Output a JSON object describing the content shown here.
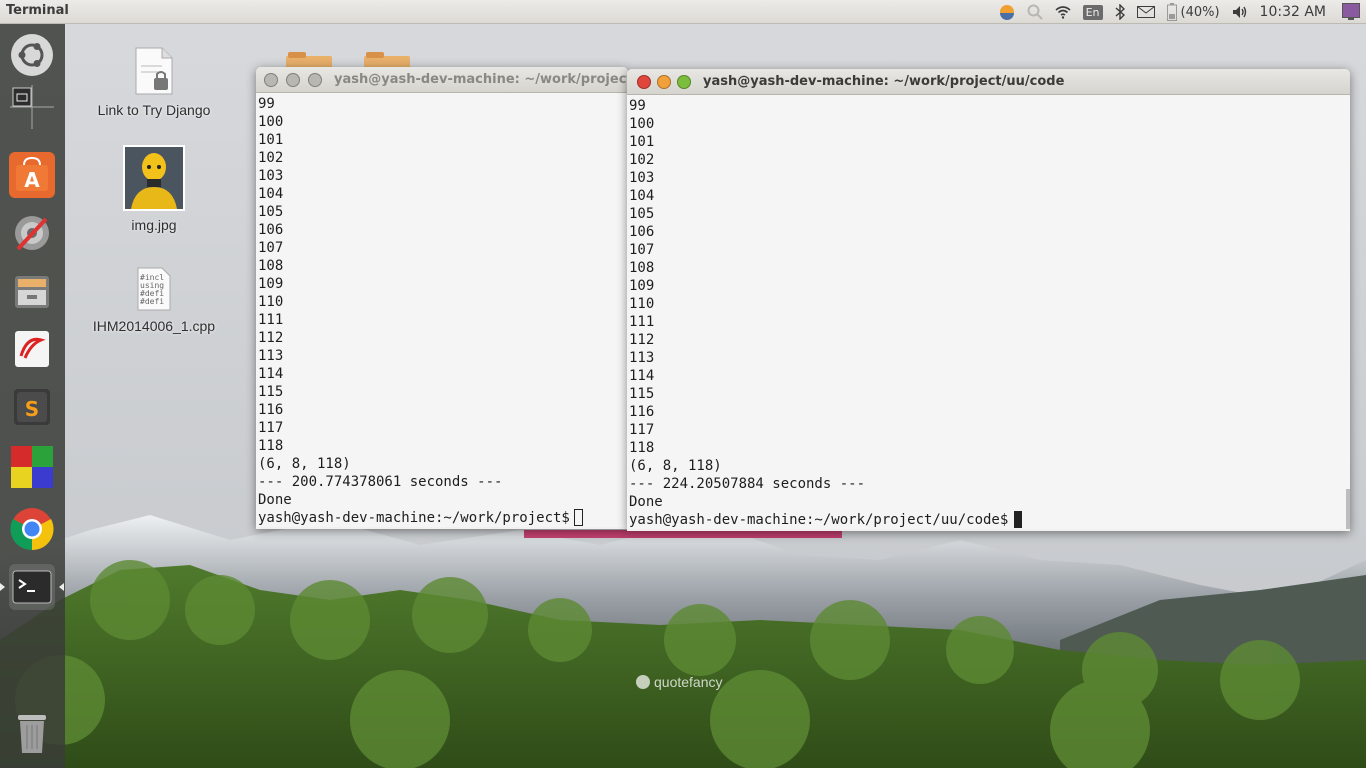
{
  "top_panel": {
    "app_title": "Terminal",
    "battery": "(40%)",
    "keyboard_layout": "En",
    "clock": "10:32 AM"
  },
  "desktop": {
    "icons": [
      {
        "label": "Link to Try Django",
        "icon": "file-link-icon"
      },
      {
        "label": "img.jpg",
        "icon": "image-thumbnail-icon"
      },
      {
        "label": "IHM2014006_1.cpp",
        "icon": "cpp-file-icon"
      }
    ],
    "watermark": "quotefancy"
  },
  "launcher": {
    "items": [
      "ubuntu-dash-icon",
      "workspace-switcher-icon",
      "software-center-icon",
      "system-settings-icon",
      "file-manager-icon",
      "document-viewer-icon",
      "sublime-text-icon",
      "puzzle-game-icon",
      "chrome-icon",
      "terminal-icon",
      "trash-icon"
    ]
  },
  "terminal_left": {
    "title": "yash@yash-dev-machine: ~/work/project",
    "lines": [
      "99",
      "100",
      "101",
      "102",
      "103",
      "104",
      "105",
      "106",
      "107",
      "108",
      "109",
      "110",
      "111",
      "112",
      "113",
      "114",
      "115",
      "116",
      "117",
      "118",
      "(6, 8, 118)",
      "--- 200.774378061 seconds ---",
      "Done"
    ],
    "prompt": "yash@yash-dev-machine:~/work/project$"
  },
  "terminal_right": {
    "title": "yash@yash-dev-machine: ~/work/project/uu/code",
    "lines": [
      "99",
      "100",
      "101",
      "102",
      "103",
      "104",
      "105",
      "106",
      "107",
      "108",
      "109",
      "110",
      "111",
      "112",
      "113",
      "114",
      "115",
      "116",
      "117",
      "118",
      "(6, 8, 118)",
      "--- 224.20507884 seconds ---",
      "Done"
    ],
    "prompt": "yash@yash-dev-machine:~/work/project/uu/code$"
  },
  "colors": {
    "close": "#e0463b",
    "minimize": "#f2a13a",
    "maximize": "#7bbd3c",
    "inactive_button": "#b9b7b1"
  }
}
